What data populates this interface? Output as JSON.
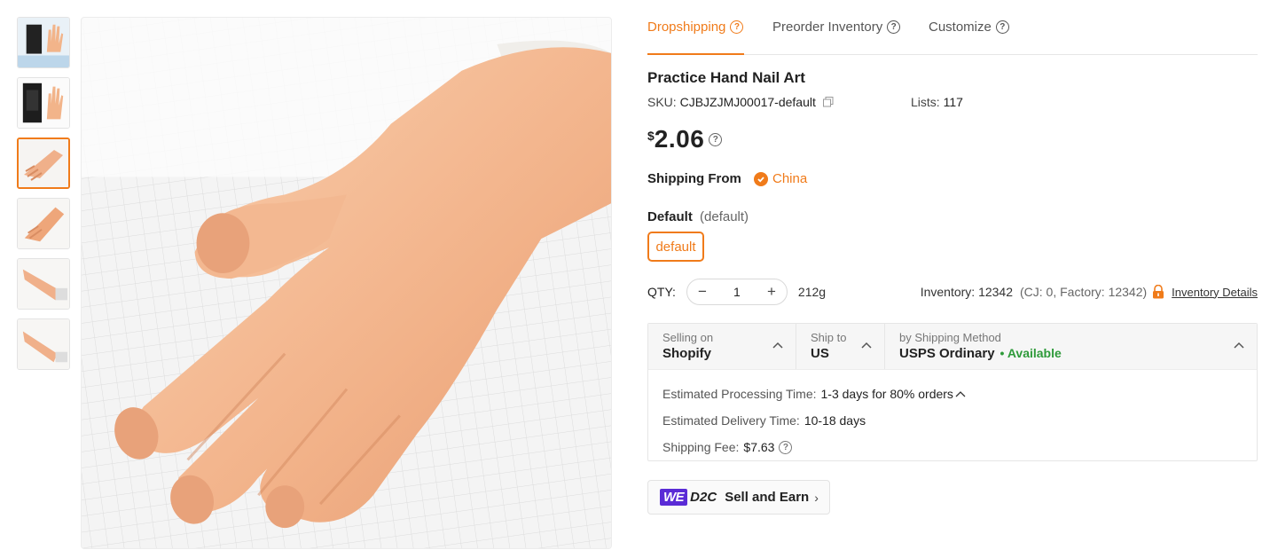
{
  "thumbnails": [
    {
      "alt": "thumb-1"
    },
    {
      "alt": "thumb-2"
    },
    {
      "alt": "thumb-3",
      "active": true
    },
    {
      "alt": "thumb-4"
    },
    {
      "alt": "thumb-5"
    },
    {
      "alt": "thumb-6"
    }
  ],
  "tabs": [
    {
      "label": "Dropshipping",
      "active": true
    },
    {
      "label": "Preorder Inventory"
    },
    {
      "label": "Customize"
    }
  ],
  "product": {
    "title": "Practice Hand Nail Art",
    "sku_label": "SKU:",
    "sku": "CJBJZJMJ00017-default",
    "lists_label": "Lists:",
    "lists": "117",
    "currency": "$",
    "price": "2.06"
  },
  "shipping_from": {
    "label": "Shipping From",
    "option": "China"
  },
  "variant": {
    "label": "Default",
    "sub": "(default)",
    "option": "default"
  },
  "qty": {
    "label": "QTY:",
    "value": "1",
    "weight": "212g",
    "inventory": "Inventory: 12342",
    "inventory_detail": "(CJ: 0, Factory: 12342)",
    "details_link": "Inventory Details"
  },
  "shipping": {
    "selling_on_label": "Selling on",
    "selling_on": "Shopify",
    "ship_to_label": "Ship to",
    "ship_to": "US",
    "method_label": "by Shipping Method",
    "method": "USPS Ordinary",
    "availability": "• Available",
    "processing_label": "Estimated Processing Time:",
    "processing": "1-3 days for 80% orders",
    "delivery_label": "Estimated Delivery Time:",
    "delivery": "10-18 days",
    "fee_label": "Shipping Fee:",
    "fee": "$7.63"
  },
  "d2c": {
    "badge": "WE",
    "brand": "D2C",
    "cta": "Sell and Earn"
  },
  "colors": {
    "accent": "#f07b1a",
    "available": "#2e9a3a",
    "we_badge": "#5a2bd6"
  }
}
